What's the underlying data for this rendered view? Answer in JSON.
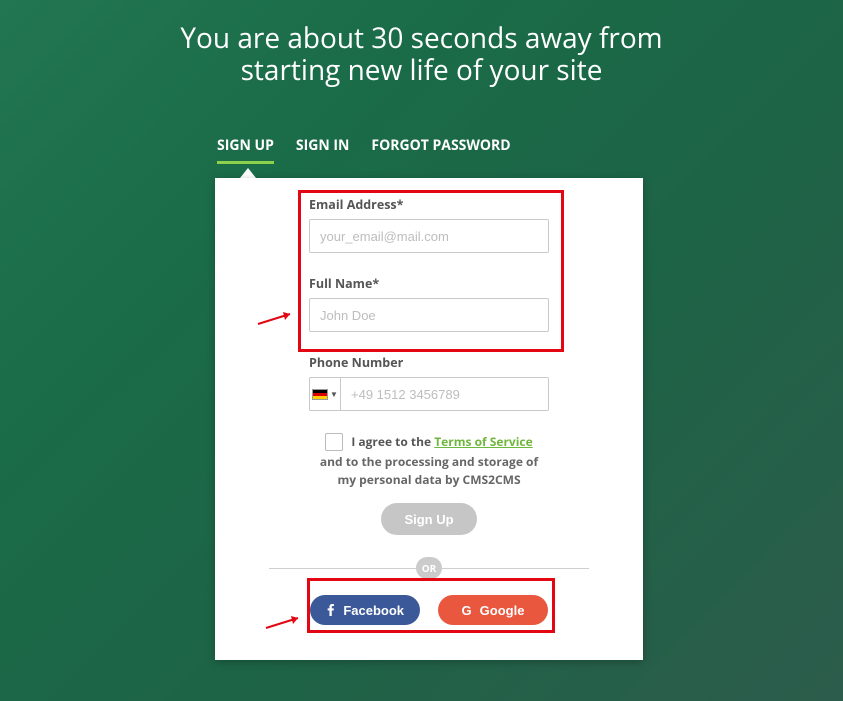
{
  "heading_line1": "You are about 30 seconds away from",
  "heading_line2": "starting new life of your site",
  "tabs": {
    "signup": "SIGN UP",
    "signin": "SIGN IN",
    "forgot": "FORGOT PASSWORD",
    "active": "signup"
  },
  "form": {
    "email": {
      "label": "Email Address*",
      "placeholder": "your_email@mail.com",
      "value": ""
    },
    "fullname": {
      "label": "Full Name*",
      "placeholder": "John Doe",
      "value": ""
    },
    "phone": {
      "label": "Phone Number",
      "placeholder": "+49 1512 3456789",
      "value": "",
      "country": "DE"
    },
    "consent": {
      "checked": false,
      "prefix": "I agree to the ",
      "link": "Terms of Service",
      "line2": "and to the processing and storage of",
      "line3": "my personal data by CMS2CMS"
    },
    "submit_label": "Sign Up",
    "or_label": "OR",
    "social": {
      "facebook": "Facebook",
      "google": "Google"
    }
  },
  "annotations": {
    "highlight_boxes": [
      "email-and-name-fields",
      "social-login-buttons"
    ],
    "arrows": 2,
    "arrow_color": "#e30613"
  }
}
